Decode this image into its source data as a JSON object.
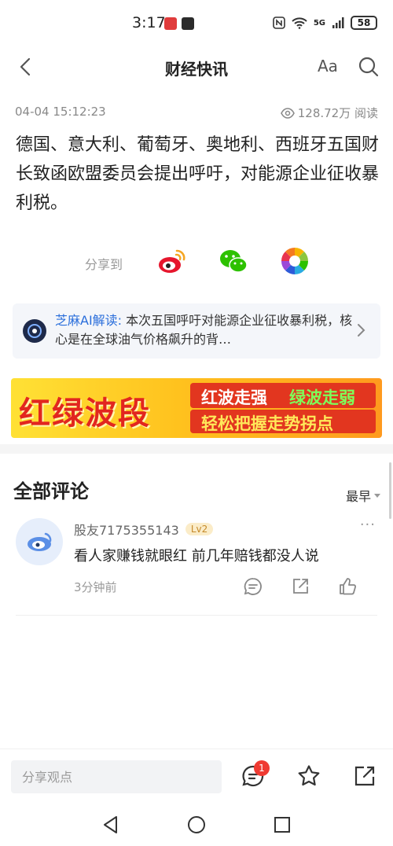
{
  "status_bar": {
    "time": "3:17",
    "battery": "58",
    "network": "5G"
  },
  "header": {
    "title": "财经快讯",
    "font_button": "Aa"
  },
  "meta": {
    "time": "04-04 15:12:23",
    "views": "128.72万 阅读"
  },
  "article": {
    "text": "德国、意大利、葡萄牙、奥地利、西班牙五国财长致函欧盟委员会提出呼吁，对能源企业征收暴利税。"
  },
  "share": {
    "label": "分享到",
    "icons": [
      "weibo-icon",
      "wechat-icon",
      "moments-icon"
    ]
  },
  "ai_card": {
    "label": "芝麻AI解读:",
    "text": " 本次五国呼吁对能源企业征收暴利税，核心是在全球油气价格飙升的背…"
  },
  "banner": {
    "title": "红绿波段",
    "tag_red": "红波走强",
    "tag_green": "绿波走弱",
    "tag_bottom": "轻松把握走势拐点"
  },
  "comments": {
    "title": "全部评论",
    "sort_label": "最早",
    "items": [
      {
        "user": "股友7175355143",
        "level": "Lv2",
        "text": "看人家赚钱就眼红 前几年赔钱都没人说",
        "time": "3分钟前",
        "more": "···"
      }
    ]
  },
  "bottom_bar": {
    "input_placeholder": "分享观点",
    "comment_badge": "1"
  },
  "colors": {
    "accent_blue": "#2a6edb",
    "badge_red": "#ef3a32",
    "banner_red": "#e2261f"
  }
}
